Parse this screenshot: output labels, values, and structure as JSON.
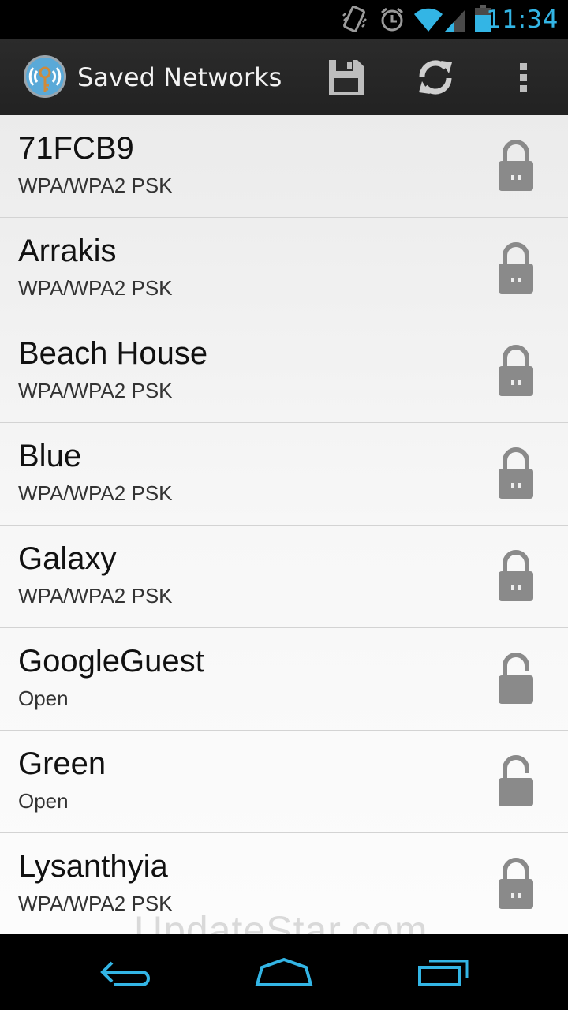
{
  "status_bar": {
    "time": "11:34",
    "icons": [
      "vibrate-icon",
      "alarm-icon",
      "wifi-icon",
      "cell-signal-icon",
      "battery-icon"
    ],
    "accent": "#33b5e5"
  },
  "action_bar": {
    "title": "Saved Networks",
    "actions": [
      "save-icon",
      "refresh-icon",
      "overflow-menu-icon"
    ]
  },
  "networks": [
    {
      "ssid": "71FCB9",
      "security": "WPA/WPA2 PSK",
      "locked": true
    },
    {
      "ssid": "Arrakis",
      "security": "WPA/WPA2 PSK",
      "locked": true
    },
    {
      "ssid": "Beach House",
      "security": "WPA/WPA2 PSK",
      "locked": true
    },
    {
      "ssid": "Blue",
      "security": "WPA/WPA2 PSK",
      "locked": true
    },
    {
      "ssid": "Galaxy",
      "security": "WPA/WPA2 PSK",
      "locked": true
    },
    {
      "ssid": "GoogleGuest",
      "security": "Open",
      "locked": false
    },
    {
      "ssid": "Green",
      "security": "Open",
      "locked": false
    },
    {
      "ssid": "Lysanthyia",
      "security": "WPA/WPA2 PSK",
      "locked": true
    }
  ],
  "watermark": "UpdateStar.com",
  "nav_bar": {
    "buttons": [
      "back-icon",
      "home-icon",
      "recent-apps-icon"
    ],
    "color": "#33b5e5"
  }
}
